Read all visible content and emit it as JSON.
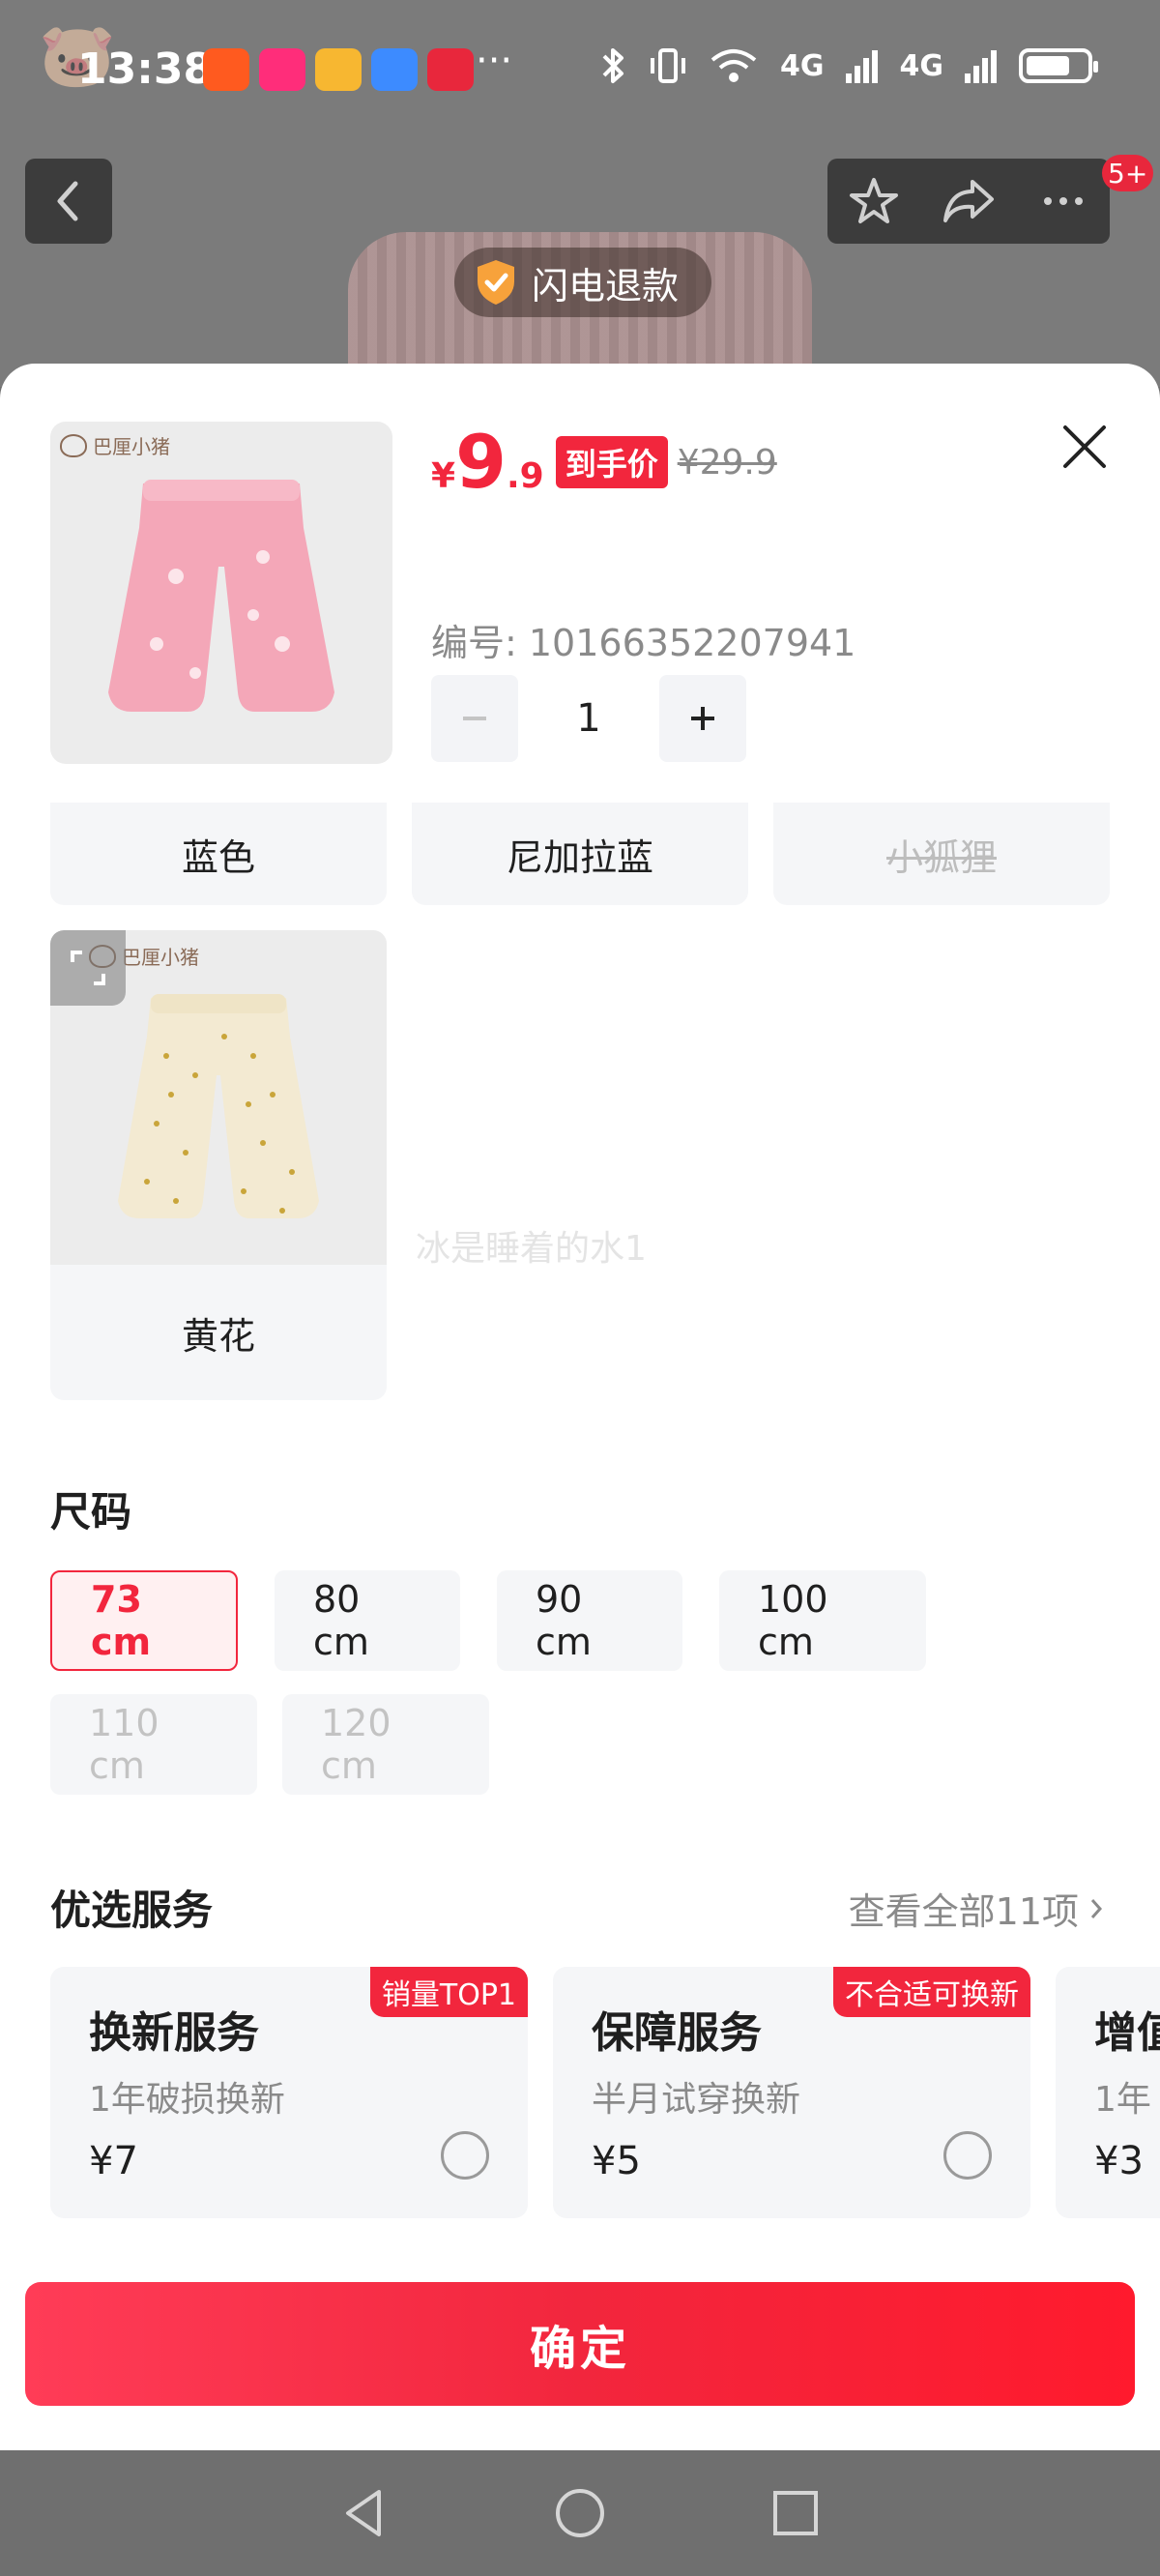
{
  "status_bar": {
    "time": "13:38",
    "more": "···",
    "network_1": "4G",
    "network_2": "4G"
  },
  "background": {
    "badge": "5+",
    "refund_label": "闪电退款"
  },
  "product": {
    "brand": "巴厘小猪",
    "price_currency": "¥",
    "price_integer": "9",
    "price_decimal": ".9",
    "final_price_tag": "到手价",
    "original_price": "¥29.9",
    "sku_label": "编号: 10166352207941",
    "quantity": "1"
  },
  "color_options": {
    "row": [
      {
        "label": "蓝色",
        "disabled": false
      },
      {
        "label": "尼加拉蓝",
        "disabled": false
      },
      {
        "label": "小狐狸",
        "disabled": true
      }
    ],
    "card": {
      "label": "黄花",
      "brand": "巴厘小猪"
    },
    "watermark": "冰是睡着的水1"
  },
  "size": {
    "title": "尺码",
    "options": [
      {
        "label": "73 cm",
        "state": "selected"
      },
      {
        "label": "80 cm",
        "state": "normal"
      },
      {
        "label": "90 cm",
        "state": "normal"
      },
      {
        "label": "100 cm",
        "state": "normal"
      },
      {
        "label": "110 cm",
        "state": "disabled"
      },
      {
        "label": "120 cm",
        "state": "disabled"
      }
    ]
  },
  "services": {
    "title": "优选服务",
    "view_all": "查看全部11项",
    "items": [
      {
        "badge": "销量TOP1",
        "name": "换新服务",
        "desc": "1年破损换新",
        "price": "¥7"
      },
      {
        "badge": "不合适可换新",
        "name": "保障服务",
        "desc": "半月试穿换新",
        "price": "¥5"
      },
      {
        "badge": "",
        "name": "增值",
        "desc": "1年",
        "price": "¥3"
      }
    ]
  },
  "confirm_label": "确定",
  "colors": {
    "accent": "#f2263d",
    "chip_bg": "#f5f6f8",
    "muted_text": "#8a8a8a"
  }
}
